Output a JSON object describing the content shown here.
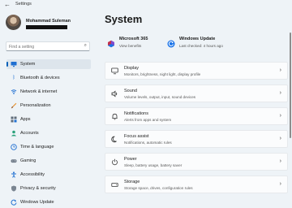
{
  "window": {
    "title": "Settings"
  },
  "user": {
    "name": "Mohammad Suleman"
  },
  "search": {
    "placeholder": "Find a setting"
  },
  "sidebar": {
    "items": [
      {
        "label": "System",
        "icon": "monitor-icon",
        "active": true
      },
      {
        "label": "Bluetooth & devices",
        "icon": "bluetooth-icon"
      },
      {
        "label": "Network & internet",
        "icon": "wifi-icon"
      },
      {
        "label": "Personalization",
        "icon": "brush-icon"
      },
      {
        "label": "Apps",
        "icon": "apps-icon"
      },
      {
        "label": "Accounts",
        "icon": "person-icon"
      },
      {
        "label": "Time & language",
        "icon": "clock-globe-icon"
      },
      {
        "label": "Gaming",
        "icon": "controller-icon"
      },
      {
        "label": "Accessibility",
        "icon": "accessibility-icon"
      },
      {
        "label": "Privacy & security",
        "icon": "shield-icon"
      },
      {
        "label": "Windows Update",
        "icon": "update-icon"
      }
    ]
  },
  "main": {
    "title": "System",
    "top_cards": [
      {
        "title": "Microsoft 365",
        "subtitle": "View benefits",
        "icon": "microsoft365-icon"
      },
      {
        "title": "Windows Update",
        "subtitle": "Last checked: 4 hours ago",
        "icon": "windows-update-icon"
      }
    ],
    "rows": [
      {
        "title": "Display",
        "subtitle": "Monitors, brightness, night light, display profile",
        "icon": "display-icon"
      },
      {
        "title": "Sound",
        "subtitle": "Volume levels, output, input, sound devices",
        "icon": "speaker-icon"
      },
      {
        "title": "Notifications",
        "subtitle": "Alerts from apps and system",
        "icon": "bell-icon"
      },
      {
        "title": "Focus assist",
        "subtitle": "Notifications, automatic rules",
        "icon": "moon-icon"
      },
      {
        "title": "Power",
        "subtitle": "Sleep, battery usage, battery saver",
        "icon": "power-icon"
      },
      {
        "title": "Storage",
        "subtitle": "Storage space, drives, configuration rules",
        "icon": "storage-icon"
      }
    ]
  },
  "colors": {
    "accent": "#005fb8",
    "background": "#eef3f7",
    "card": "#fbfcfd"
  }
}
